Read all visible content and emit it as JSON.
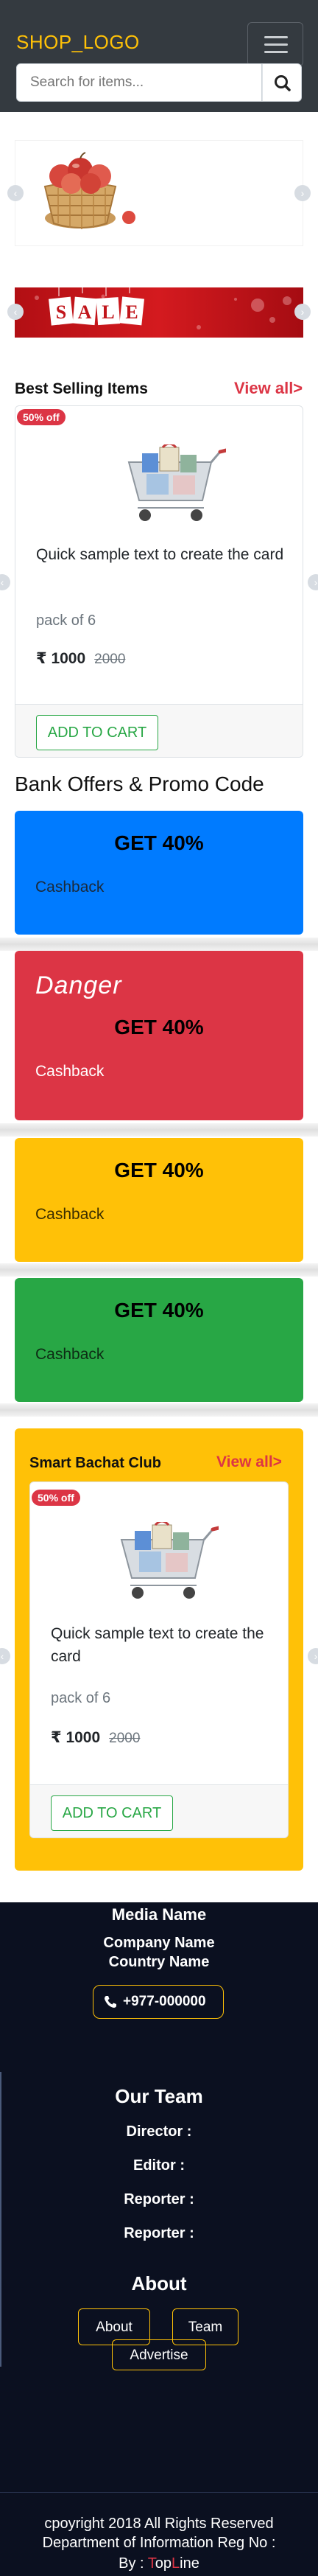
{
  "header": {
    "logo": "SHOP_LOGO",
    "search_placeholder": "Search for items...",
    "colors": {
      "bar": "#343a40",
      "logo": "#ffc107"
    }
  },
  "carousel": {
    "slides": [
      "apple-basket-image",
      "sale-banner-image"
    ],
    "sale_banner_text": "SALE"
  },
  "best_selling": {
    "title": "Best Selling Items",
    "view_all": "View all>",
    "product": {
      "badge": "50% off",
      "title": "Quick sample text to create the card",
      "pack": "pack of 6",
      "price": "₹ 1000",
      "old_price": "2000",
      "cta": "ADD TO CART"
    }
  },
  "offers": {
    "title": "Bank Offers & Promo Code",
    "cards": [
      {
        "heading": "GET 40%",
        "cashback": "Cashback",
        "color": "#007bff"
      },
      {
        "overlay": "Danger",
        "heading": "GET 40%",
        "cashback": "Cashback",
        "color": "#dc3545"
      },
      {
        "heading": "GET 40%",
        "cashback": "Cashback",
        "color": "#ffc107"
      },
      {
        "heading": "GET 40%",
        "cashback": "Cashback",
        "color": "#28a745"
      }
    ]
  },
  "smart_club": {
    "title": "Smart Bachat Club",
    "view_all": "View all>",
    "product": {
      "badge": "50% off",
      "title": "Quick sample text to create the card",
      "pack": "pack of 6",
      "price": "₹ 1000",
      "old_price": "2000",
      "cta": "ADD TO CART"
    }
  },
  "footer": {
    "media_name": "Media Name",
    "company_name": "Company Name",
    "country_name": "Country Name",
    "phone": "+977-000000",
    "team_title": "Our Team",
    "team": [
      "Director :",
      "Editor :",
      "Reporter :",
      "Reporter :"
    ],
    "about_title": "About",
    "links": [
      "About",
      "Team",
      "Advertise"
    ],
    "copyright": "cpoyright 2018 All Rights Reserved",
    "department": "Department of Information Reg No :",
    "by_label": "By :",
    "brand_first": "T",
    "brand_mid": "op",
    "brand_l": "L",
    "brand_rest": "ine"
  }
}
